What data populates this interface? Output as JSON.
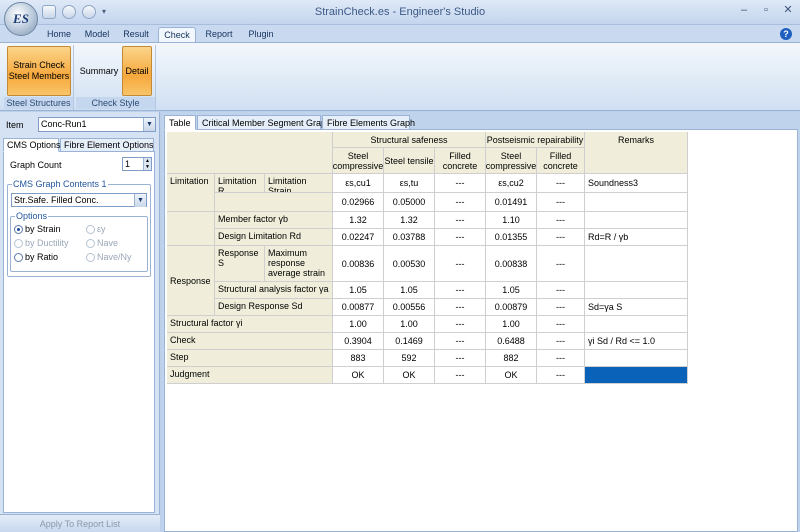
{
  "window": {
    "title": "StrainCheck.es - Engineer's Studio",
    "logo_text": "ES",
    "controls": [
      "–",
      "▫",
      "✕"
    ]
  },
  "ribbon": {
    "tabs": [
      "Home",
      "Model",
      "Result",
      "Check",
      "Report",
      "Plugin"
    ],
    "active_tab": "Check",
    "groups": [
      {
        "label": "Steel Structures",
        "buttons": [
          "Strain Check Steel Members"
        ]
      },
      {
        "label": "Check Style",
        "buttons": [
          "Summary",
          "Detail"
        ]
      }
    ]
  },
  "left_panel": {
    "item_label": "Item",
    "item_value": "Conc-Run1",
    "tabs": [
      "CMS Options",
      "Fibre Element Options"
    ],
    "graph_count_label": "Graph Count",
    "graph_count_value": "1",
    "cms_contents_legend": "CMS Graph Contents 1",
    "cms_contents_value": "Str.Safe. Filled Conc.",
    "options_legend": "Options",
    "options": {
      "by_strain": "by Strain",
      "by_ductility": "by Ductility",
      "by_ratio": "by Ratio",
      "ey": "εy",
      "nave": "Nave",
      "nave_ny": "Nave/Ny"
    },
    "apply_button": "Apply To Report List"
  },
  "main": {
    "tabs": [
      "Table",
      "Critical Member Segment Graph",
      "Fibre Elements Graph"
    ],
    "table": {
      "group_headers": {
        "structural_safeness": "Structural safeness",
        "postseismic": "Postseismic repairability",
        "remarks": "Remarks"
      },
      "col_headers": [
        "Steel compressive",
        "Steel tensile",
        "Filled concrete",
        "Steel compressive",
        "Filled concrete"
      ],
      "row_headers": {
        "limitation": "Limitation",
        "limitation_r": "Limitation R",
        "limitation_strain": "Limitation Strain",
        "member_factor": "Member factor γb",
        "design_limitation": "Design Limitation Rd",
        "response": "Response",
        "response_s": "Response S",
        "max_response": "Maximum response average strain",
        "structural_analysis_factor": "Structural analysis factor γa",
        "design_response": "Design Response Sd",
        "structural_factor": "Structural factor γi",
        "check": "Check",
        "step": "Step",
        "judgment": "Judgment"
      },
      "rows": {
        "limit_symbol": [
          "εs,cu1",
          "εs,tu",
          "---",
          "εs,cu2",
          "---"
        ],
        "limit_strain": [
          "0.02966",
          "0.05000",
          "---",
          "0.01491",
          "---"
        ],
        "member_factor": [
          "1.32",
          "1.32",
          "---",
          "1.10",
          "---"
        ],
        "design_limitation": [
          "0.02247",
          "0.03788",
          "---",
          "0.01355",
          "---"
        ],
        "max_response": [
          "0.00836",
          "0.00530",
          "---",
          "0.00838",
          "---"
        ],
        "analysis_factor": [
          "1.05",
          "1.05",
          "---",
          "1.05",
          "---"
        ],
        "design_response": [
          "0.00877",
          "0.00556",
          "---",
          "0.00879",
          "---"
        ],
        "structural_factor": [
          "1.00",
          "1.00",
          "---",
          "1.00",
          "---"
        ],
        "check": [
          "0.3904",
          "0.1469",
          "---",
          "0.6488",
          "---"
        ],
        "step": [
          "883",
          "592",
          "---",
          "882",
          "---"
        ],
        "judgment": [
          "OK",
          "OK",
          "---",
          "OK",
          "---"
        ]
      },
      "remarks": {
        "limit_symbol": "Soundness3",
        "design_limitation": "Rd=R / γb",
        "design_response": "Sd=γa S",
        "check": "γi Sd / Rd <= 1.0"
      }
    }
  },
  "colors": {
    "header_bg": "#f0eeda",
    "judgment_remark": "#0a63b8",
    "ribbon_pressed": "#f6a83c"
  }
}
